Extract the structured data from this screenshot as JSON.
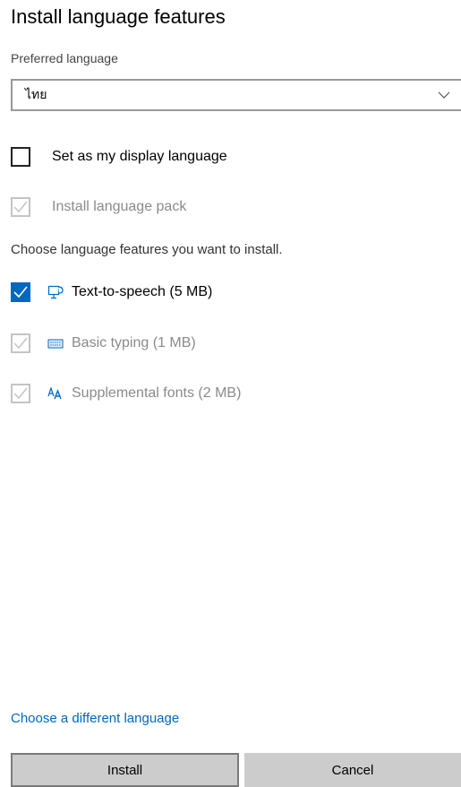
{
  "dialog": {
    "title": "Install language features",
    "preferred_label": "Preferred language",
    "selected_language": "ไทย"
  },
  "options": {
    "display_language": {
      "label": "Set as my display language",
      "checked": false
    },
    "language_pack": {
      "label": "Install language pack",
      "checked": true,
      "disabled": true
    }
  },
  "features": {
    "heading": "Choose language features you want to install.",
    "items": [
      {
        "label": "Text-to-speech (5 MB)",
        "icon": "speech-icon",
        "checked": true,
        "disabled": false
      },
      {
        "label": "Basic typing (1 MB)",
        "icon": "keyboard-icon",
        "checked": true,
        "disabled": true
      },
      {
        "label": "Supplemental fonts (2 MB)",
        "icon": "font-icon",
        "checked": true,
        "disabled": true
      }
    ]
  },
  "footer": {
    "link": "Choose a different language",
    "install": "Install",
    "cancel": "Cancel"
  },
  "colors": {
    "accent": "#0067c0",
    "disabled": "#8a8a8a"
  }
}
